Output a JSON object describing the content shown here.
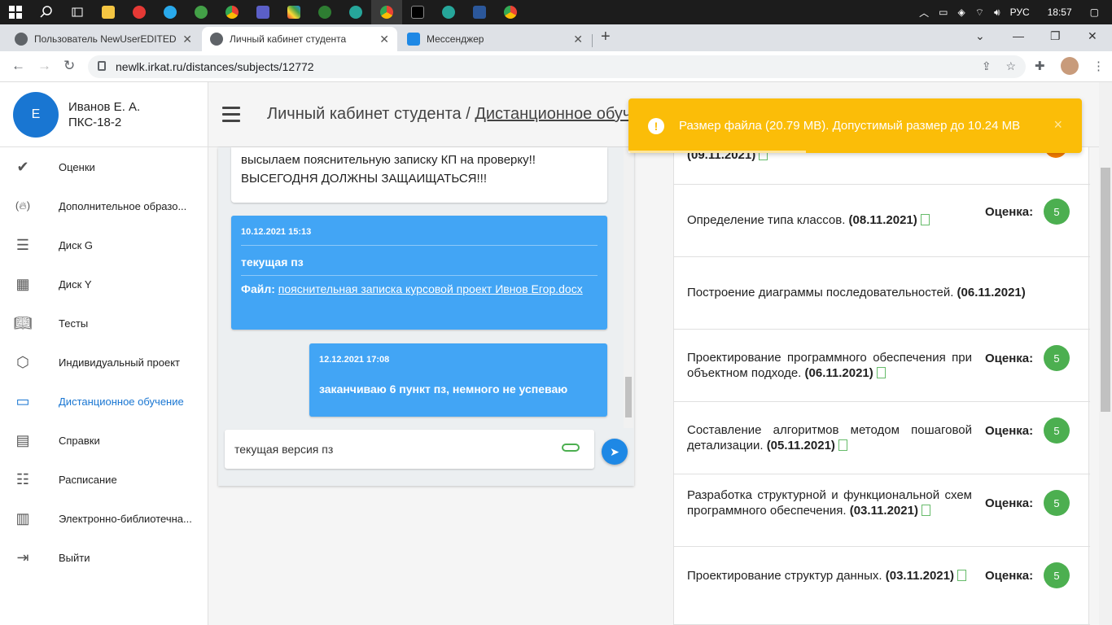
{
  "taskbar": {
    "lang": "РУС",
    "time": "18:57"
  },
  "tabs": [
    {
      "label": "Пользователь NewUserEDITED"
    },
    {
      "label": "Личный кабинет студента"
    },
    {
      "label": "Мессенджер"
    }
  ],
  "address": {
    "url": "newlk.irkat.ru/distances/subjects/12772"
  },
  "user": {
    "initial": "E",
    "name": "Иванов Е. А.",
    "group": "ПКС-18-2"
  },
  "menu": [
    {
      "label": "Оценки",
      "icon": "check-icon"
    },
    {
      "label": "Дополнительное образо...",
      "icon": "fire-icon"
    },
    {
      "label": "Диск G",
      "icon": "server-icon"
    },
    {
      "label": "Диск Y",
      "icon": "building-icon"
    },
    {
      "label": "Тесты",
      "icon": "book-open-icon"
    },
    {
      "label": "Индивидуальный проект",
      "icon": "cube-icon"
    },
    {
      "label": "Дистанционное обучение",
      "icon": "laptop-icon",
      "active": true
    },
    {
      "label": "Справки",
      "icon": "book-icon"
    },
    {
      "label": "Расписание",
      "icon": "list-icon"
    },
    {
      "label": "Электронно-библиотечна...",
      "icon": "book2-icon"
    },
    {
      "label": "Выйти",
      "icon": "logout-icon"
    }
  ],
  "header": {
    "title_prefix": "Личный кабинет студента / ",
    "title_link": "Дистанционное обуч"
  },
  "chat": {
    "partial_message_line1": "высылаем пояснительную записку КП на проверку!!",
    "partial_message_line2": "ВЫСЕГОДНЯ ДОЛЖНЫ ЗАЩАИЩАТЬСЯ!!!",
    "msg1": {
      "date": "10.12.2021 15:13",
      "text": "текущая пз",
      "file_label": "Файл: ",
      "file_name": "пояснительная записка курсовой проект Ивнов Егор.docx"
    },
    "msg2": {
      "date": "12.12.2021 17:08",
      "text": "заканчиваю 6 пункт пз, немного не успеваю"
    },
    "input_value": "текущая версия пз"
  },
  "subjects": {
    "grade_label": "Оценка:",
    "rows": [
      {
        "title": "",
        "date": "(09.11.2021)",
        "has_doc": true,
        "grade": ""
      },
      {
        "title": "Определение типа классов. ",
        "date": "(08.11.2021)",
        "has_doc": true,
        "grade": "5"
      },
      {
        "title": "Построение диаграммы последовательностей. ",
        "date": "(06.11.2021)",
        "has_doc": false,
        "grade": ""
      },
      {
        "title": "Проектирование программного обеспечения при объектном подходе. ",
        "date": "(06.11.2021)",
        "has_doc": true,
        "grade": "5"
      },
      {
        "title": "Составление алгоритмов методом пошаговой детализации. ",
        "date": "(05.11.2021)",
        "has_doc": true,
        "grade": "5"
      },
      {
        "title": "Разработка структурной и функциональной схем программного обеспечения. ",
        "date": "(03.11.2021)",
        "has_doc": true,
        "grade": "5"
      },
      {
        "title": "Проектирование структур данных. ",
        "date": "(03.11.2021)",
        "has_doc": true,
        "grade": "5"
      }
    ]
  },
  "toast": {
    "message": "Размер файла (20.79 MB). Допустимый размер до 10.24 MB",
    "close": "×"
  },
  "colors": {
    "accent": "#1976d2",
    "bubble": "#42a5f5",
    "grade": "#4caf50",
    "toast": "#fbbd08"
  }
}
